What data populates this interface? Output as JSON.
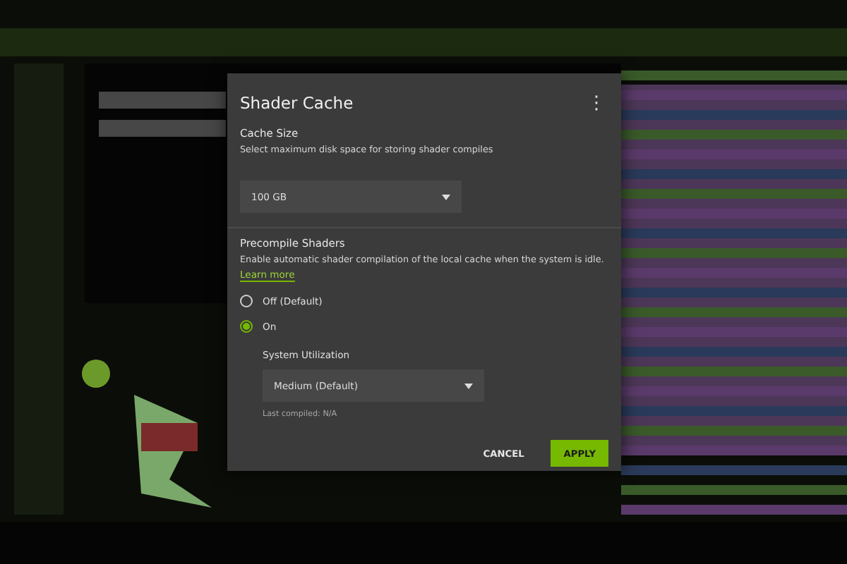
{
  "dialog": {
    "title": "Shader Cache",
    "menu_icon": "⋮",
    "cache_size": {
      "title": "Cache Size",
      "description": "Select maximum disk space for storing shader compiles",
      "value": "100 GB"
    },
    "precompile": {
      "title": "Precompile Shaders",
      "description": "Enable automatic shader compilation of the local cache when the system is idle.",
      "link": "Learn more",
      "options": [
        {
          "label": "Off (Default)",
          "selected": false
        },
        {
          "label": "On",
          "selected": true
        }
      ],
      "utilization": {
        "label": "System Utilization",
        "value": "Medium (Default)"
      },
      "last_compiled": "Last compiled: N/A"
    },
    "buttons": [
      {
        "label": "CANCEL",
        "kind": "text"
      },
      {
        "label": "APPLY",
        "kind": "primary"
      }
    ]
  }
}
